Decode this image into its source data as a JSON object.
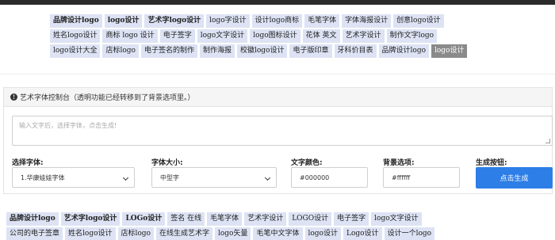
{
  "top_tags": [
    [
      {
        "label": "品牌设计logo",
        "bold": true
      },
      {
        "label": "logo设计",
        "bold": true
      },
      {
        "label": "艺术字logo设计",
        "bold": true
      },
      {
        "label": "logo字设计",
        "bold": false
      },
      {
        "label": "设计logo商标",
        "bold": false
      },
      {
        "label": "毛笔字体",
        "bold": false
      },
      {
        "label": "字体海报设计",
        "bold": false
      },
      {
        "label": "创意logo设计",
        "bold": false
      }
    ],
    [
      {
        "label": "姓名logo设计",
        "bold": false
      },
      {
        "label": "商标 logo 设计",
        "bold": false
      },
      {
        "label": "电子签字",
        "bold": false
      },
      {
        "label": "logo文字设计",
        "bold": false
      },
      {
        "label": "logo图标设计",
        "bold": false
      },
      {
        "label": "花体 英文",
        "bold": false
      },
      {
        "label": "艺术字设计",
        "bold": false
      },
      {
        "label": "制作文字logo",
        "bold": false
      }
    ],
    [
      {
        "label": "logo设计大全",
        "bold": false
      },
      {
        "label": "店标logo",
        "bold": false
      },
      {
        "label": "电子签名的制作",
        "bold": false
      },
      {
        "label": "制作海报",
        "bold": false
      },
      {
        "label": "校徽logo设计",
        "bold": false
      },
      {
        "label": "电子版印章",
        "bold": false
      },
      {
        "label": "牙科价目表",
        "bold": false
      },
      {
        "label": "品牌设计logo",
        "bold": false
      },
      {
        "label": "logo设计",
        "bold": false,
        "dark": true
      }
    ]
  ],
  "panel": {
    "header": "艺术字体控制台（透明功能已经转移到了背景选项里。）",
    "textarea_placeholder": "输入文字后，选择字体，点击生成!",
    "font_label": "选择字体:",
    "font_value": "1.华康娃娃字体",
    "size_label": "字体大小:",
    "size_value": "中型字",
    "color_label": "文字颜色:",
    "color_value": "#000000",
    "bg_label": "背景选项:",
    "bg_value": "#ffffff",
    "button_label": "生成按钮:",
    "generate_button": "点击生成"
  },
  "bottom_tags": [
    [
      {
        "label": "品牌设计logo",
        "bold": true
      },
      {
        "label": "艺术字logo设计",
        "bold": true
      },
      {
        "label": "LOGo设计",
        "bold": true
      },
      {
        "label": "签名 在线",
        "bold": false
      },
      {
        "label": "毛笔字体",
        "bold": false
      },
      {
        "label": "艺术字设计",
        "bold": false
      },
      {
        "label": "LOGO设计",
        "bold": false
      },
      {
        "label": "电子签字",
        "bold": false
      },
      {
        "label": "logo文字设计",
        "bold": false
      }
    ],
    [
      {
        "label": "公司的电子签章",
        "bold": false
      },
      {
        "label": "姓名logo设计",
        "bold": false
      },
      {
        "label": "店标logo",
        "bold": false
      },
      {
        "label": "在线生成艺术字",
        "bold": false
      },
      {
        "label": "logo矢量",
        "bold": false
      },
      {
        "label": "毛笔中文字体",
        "bold": false
      },
      {
        "label": "logo设计",
        "bold": false
      },
      {
        "label": "Logo设计",
        "bold": false
      },
      {
        "label": "设计一个logo",
        "bold": false
      }
    ]
  ]
}
